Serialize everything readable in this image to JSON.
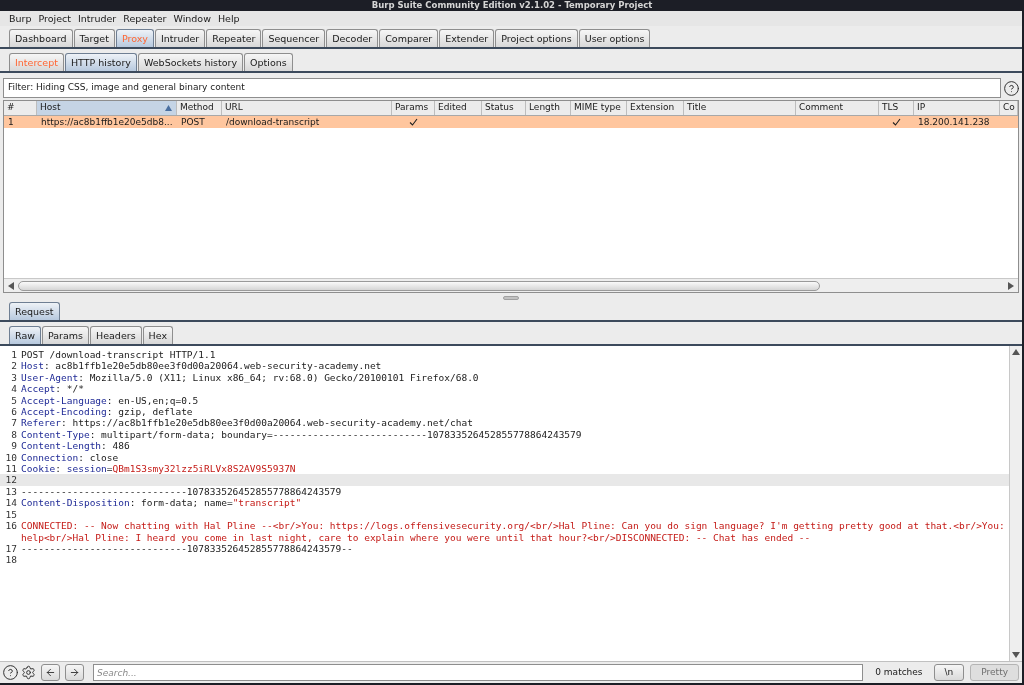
{
  "window": {
    "title": "Burp Suite Community Edition v2.1.02 - Temporary Project"
  },
  "menu_bar": [
    "Burp",
    "Project",
    "Intruder",
    "Repeater",
    "Window",
    "Help"
  ],
  "main_tabs": [
    {
      "label": "Dashboard",
      "selected": false,
      "alert": false
    },
    {
      "label": "Target",
      "selected": false,
      "alert": false
    },
    {
      "label": "Proxy",
      "selected": true,
      "alert": true
    },
    {
      "label": "Intruder",
      "selected": false,
      "alert": false
    },
    {
      "label": "Repeater",
      "selected": false,
      "alert": false
    },
    {
      "label": "Sequencer",
      "selected": false,
      "alert": false
    },
    {
      "label": "Decoder",
      "selected": false,
      "alert": false
    },
    {
      "label": "Comparer",
      "selected": false,
      "alert": false
    },
    {
      "label": "Extender",
      "selected": false,
      "alert": false
    },
    {
      "label": "Project options",
      "selected": false,
      "alert": false
    },
    {
      "label": "User options",
      "selected": false,
      "alert": false
    }
  ],
  "proxy_tabs": [
    {
      "label": "Intercept",
      "selected": false,
      "alert": true
    },
    {
      "label": "HTTP history",
      "selected": true,
      "alert": false
    },
    {
      "label": "WebSockets history",
      "selected": false,
      "alert": false
    },
    {
      "label": "Options",
      "selected": false,
      "alert": false
    }
  ],
  "filter": {
    "text": "Filter: Hiding CSS, image and general binary content"
  },
  "table": {
    "columns": [
      {
        "label": "#",
        "sorted": false
      },
      {
        "label": "Host",
        "sorted": true
      },
      {
        "label": "Method",
        "sorted": false
      },
      {
        "label": "URL",
        "sorted": false
      },
      {
        "label": "Params",
        "sorted": false
      },
      {
        "label": "Edited",
        "sorted": false
      },
      {
        "label": "Status",
        "sorted": false
      },
      {
        "label": "Length",
        "sorted": false
      },
      {
        "label": "MIME type",
        "sorted": false
      },
      {
        "label": "Extension",
        "sorted": false
      },
      {
        "label": "Title",
        "sorted": false
      },
      {
        "label": "Comment",
        "sorted": false
      },
      {
        "label": "TLS",
        "sorted": false
      },
      {
        "label": "IP",
        "sorted": false
      },
      {
        "label": "Co",
        "sorted": false
      }
    ],
    "rows": [
      {
        "selected": true,
        "number": "1",
        "host": "https://ac8b1ffb1e20e5db8...",
        "method": "POST",
        "url": "/download-transcript",
        "params": true,
        "tls": true,
        "ip": "18.200.141.238"
      }
    ]
  },
  "message_tabs": [
    {
      "label": "Request",
      "selected": true
    }
  ],
  "view_tabs": [
    {
      "label": "Raw",
      "selected": true
    },
    {
      "label": "Params",
      "selected": false
    },
    {
      "label": "Headers",
      "selected": false
    },
    {
      "label": "Hex",
      "selected": false
    }
  ],
  "editor": {
    "lines": [
      {
        "number": "1",
        "current": false,
        "segments": [
          {
            "kind": "plain",
            "text": "POST /download-transcript HTTP/1.1"
          }
        ]
      },
      {
        "number": "2",
        "current": false,
        "segments": [
          {
            "kind": "name",
            "text": "Host"
          },
          {
            "kind": "plain",
            "text": ": ac8b1ffb1e20e5db80ee3f0d00a20064.web-security-academy.net"
          }
        ]
      },
      {
        "number": "3",
        "current": false,
        "segments": [
          {
            "kind": "name",
            "text": "User-Agent"
          },
          {
            "kind": "plain",
            "text": ": Mozilla/5.0 (X11; Linux x86_64; rv:68.0) Gecko/20100101 Firefox/68.0"
          }
        ]
      },
      {
        "number": "4",
        "current": false,
        "segments": [
          {
            "kind": "name",
            "text": "Accept"
          },
          {
            "kind": "plain",
            "text": ": */*"
          }
        ]
      },
      {
        "number": "5",
        "current": false,
        "segments": [
          {
            "kind": "name",
            "text": "Accept-Language"
          },
          {
            "kind": "plain",
            "text": ": en-US,en;q=0.5"
          }
        ]
      },
      {
        "number": "6",
        "current": false,
        "segments": [
          {
            "kind": "name",
            "text": "Accept-Encoding"
          },
          {
            "kind": "plain",
            "text": ": gzip, deflate"
          }
        ]
      },
      {
        "number": "7",
        "current": false,
        "segments": [
          {
            "kind": "name",
            "text": "Referer"
          },
          {
            "kind": "plain",
            "text": ": https://ac8b1ffb1e20e5db80ee3f0d00a20064.web-security-academy.net/chat"
          }
        ]
      },
      {
        "number": "8",
        "current": false,
        "segments": [
          {
            "kind": "name",
            "text": "Content-Type"
          },
          {
            "kind": "plain",
            "text": ": multipart/form-data; boundary=---------------------------107833526452855778864243579"
          }
        ]
      },
      {
        "number": "9",
        "current": false,
        "segments": [
          {
            "kind": "name",
            "text": "Content-Length"
          },
          {
            "kind": "plain",
            "text": ": 486"
          }
        ]
      },
      {
        "number": "10",
        "current": false,
        "segments": [
          {
            "kind": "name",
            "text": "Connection"
          },
          {
            "kind": "plain",
            "text": ": close"
          }
        ]
      },
      {
        "number": "11",
        "current": false,
        "segments": [
          {
            "kind": "name",
            "text": "Cookie"
          },
          {
            "kind": "plain",
            "text": ": "
          },
          {
            "kind": "name",
            "text": "session"
          },
          {
            "kind": "plain",
            "text": "="
          },
          {
            "kind": "value",
            "text": "QBm1S3smy32lzz5iRLVx8S2AV9S5937N"
          }
        ]
      },
      {
        "number": "12",
        "current": true
      },
      {
        "number": "13",
        "current": false,
        "segments": [
          {
            "kind": "plain",
            "text": "-----------------------------107833526452855778864243579"
          }
        ]
      },
      {
        "number": "14",
        "current": false,
        "segments": [
          {
            "kind": "name",
            "text": "Content-Disposition"
          },
          {
            "kind": "plain",
            "text": ": form-data; name="
          },
          {
            "kind": "value",
            "text": "\"transcript\""
          }
        ]
      },
      {
        "number": "15",
        "current": false
      },
      {
        "number": "16",
        "current": false,
        "segments": [
          {
            "kind": "value",
            "text": "CONNECTED: -- Now chatting with Hal Pline --<br/>You: https://logs.offensivesecurity.org/<br/>Hal Pline: Can you do sign language? I'm getting pretty good at that.<br/>You: help<br/>Hal Pline: I heard you come in last night, care to explain where you were until that hour?<br/>DISCONNECTED: -- Chat has ended --"
          }
        ]
      },
      {
        "number": "17",
        "current": false,
        "segments": [
          {
            "kind": "plain",
            "text": "-----------------------------107833526452855778864243579--"
          }
        ]
      },
      {
        "number": "18",
        "current": false
      }
    ]
  },
  "search_bar": {
    "placeholder": "Search...",
    "matches": "0 matches",
    "buttons": [
      {
        "label": "\\n",
        "disabled": false
      },
      {
        "label": "Pretty",
        "disabled": true
      }
    ]
  }
}
